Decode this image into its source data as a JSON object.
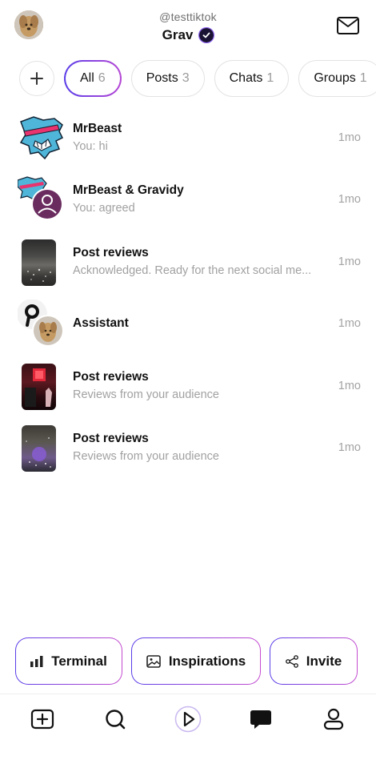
{
  "header": {
    "handle": "@testtiktok",
    "name": "Grav"
  },
  "chips": [
    {
      "label": "All",
      "count": "6"
    },
    {
      "label": "Posts",
      "count": "3"
    },
    {
      "label": "Chats",
      "count": "1"
    },
    {
      "label": "Groups",
      "count": "1"
    }
  ],
  "conversations": [
    {
      "title": "MrBeast",
      "subtitle": "You: hi",
      "time": "1mo"
    },
    {
      "title": "MrBeast & Gravidy",
      "subtitle": "You: agreed",
      "time": "1mo"
    },
    {
      "title": "Post reviews",
      "subtitle": "Acknowledged. Ready for the next social me...",
      "time": "1mo"
    },
    {
      "title": "Assistant",
      "subtitle": "",
      "time": "1mo"
    },
    {
      "title": "Post reviews",
      "subtitle": "Reviews from your audience",
      "time": "1mo"
    },
    {
      "title": "Post reviews",
      "subtitle": "Reviews from your audience",
      "time": "1mo"
    }
  ],
  "actions": {
    "terminal": "Terminal",
    "inspirations": "Inspirations",
    "invite": "Invite"
  },
  "icons": {
    "nav": [
      "create-icon",
      "search-icon",
      "play-icon",
      "chat-icon",
      "profile-icon"
    ],
    "header": [
      "avatar",
      "verified-icon",
      "mail-icon"
    ]
  },
  "colors": {
    "accent_start": "#5b3ee8",
    "accent_end": "#c44bd0",
    "verified": "#1a1334"
  }
}
